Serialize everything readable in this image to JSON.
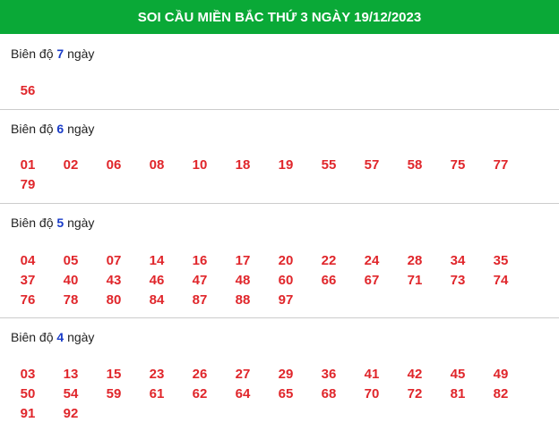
{
  "header": {
    "title": "SOI CẦU MIỀN BẮC THỨ 3 NGÀY 19/12/2023"
  },
  "sections": [
    {
      "prefix": "Biên độ",
      "days": "7",
      "suffix": "ngày",
      "numbers": [
        "56"
      ]
    },
    {
      "prefix": "Biên độ",
      "days": "6",
      "suffix": "ngày",
      "numbers": [
        "01",
        "02",
        "06",
        "08",
        "10",
        "18",
        "19",
        "55",
        "57",
        "58",
        "75",
        "77",
        "79"
      ]
    },
    {
      "prefix": "Biên độ",
      "days": "5",
      "suffix": "ngày",
      "numbers": [
        "04",
        "05",
        "07",
        "14",
        "16",
        "17",
        "20",
        "22",
        "24",
        "28",
        "34",
        "35",
        "37",
        "40",
        "43",
        "46",
        "47",
        "48",
        "60",
        "66",
        "67",
        "71",
        "73",
        "74",
        "76",
        "78",
        "80",
        "84",
        "87",
        "88",
        "97"
      ]
    },
    {
      "prefix": "Biên độ",
      "days": "4",
      "suffix": "ngày",
      "numbers": [
        "03",
        "13",
        "15",
        "23",
        "26",
        "27",
        "29",
        "36",
        "41",
        "42",
        "45",
        "49",
        "50",
        "54",
        "59",
        "61",
        "62",
        "64",
        "65",
        "68",
        "70",
        "72",
        "81",
        "82",
        "91",
        "92"
      ]
    }
  ],
  "colors": {
    "header_bg": "#0aa937",
    "number": "#e0262b",
    "days": "#1a3cc8"
  }
}
